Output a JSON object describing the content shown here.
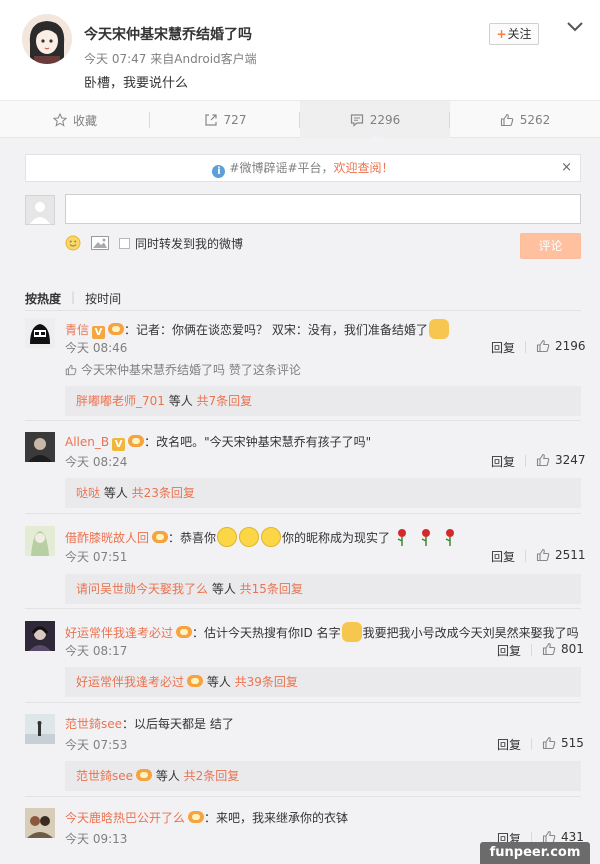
{
  "post": {
    "author": "今天宋仲基宋慧乔结婚了吗",
    "time": "今天 07:47",
    "source_prefix": "来自",
    "source": "Android客户端",
    "text": "卧槽，我要说什么",
    "follow_label": "关注"
  },
  "actions": {
    "favorite": "收藏",
    "repost": "727",
    "comment": "2296",
    "like": "5262"
  },
  "notice": {
    "text": "#微博辟谣#平台，",
    "welcome": "欢迎查阅！",
    "close": "×"
  },
  "composer": {
    "repost_label": "同时转发到我的微博",
    "submit": "评论"
  },
  "sort": {
    "hot": "按热度",
    "time": "按时间"
  },
  "comments": [
    {
      "name": "青信",
      "text": "：记者：你俩在谈恋爱吗？ 双宋：没有，我们准备结婚了",
      "time": "今天 08:46",
      "reply": "回复",
      "likes": "2196",
      "liked_note": "今天宋仲基宋慧乔结婚了吗 赞了这条评论",
      "sub_name": "胖嘟嘟老师_701",
      "sub_mid": " 等人 ",
      "sub_count": "共7条回复"
    },
    {
      "name": "Allen_B",
      "text": "：改名吧。\"今天宋钟基宋慧乔有孩子了吗\"",
      "time": "今天 08:24",
      "reply": "回复",
      "likes": "3247",
      "sub_name": "哒哒",
      "sub_mid": " 等人 ",
      "sub_count": "共23条回复"
    },
    {
      "name": "借酢膝晄故人回",
      "text_a": "：恭喜你",
      "text_b": "你的昵称成为现实了",
      "time": "今天 07:51",
      "reply": "回复",
      "likes": "2511",
      "sub_name": "请问吴世勋今天娶我了么",
      "sub_mid": " 等人 ",
      "sub_count": "共15条回复"
    },
    {
      "name": "好运常伴我逢考必过",
      "text_a": "：估计今天热搜有你ID 名字",
      "text_b": "我要把我小号改成今天刘昊然来娶我了吗",
      "time": "今天 08:17",
      "reply": "回复",
      "likes": "801",
      "sub_name": "好运常伴我逢考必过",
      "sub_mid": " 等人 ",
      "sub_count": "共39条回复"
    },
    {
      "name": "范世錡see",
      "text": "：以后每天都是 结了",
      "time": "今天 07:53",
      "reply": "回复",
      "likes": "515",
      "sub_name": "范世錡see",
      "sub_mid": " 等人 ",
      "sub_count": "共2条回复"
    },
    {
      "name": "今天鹿晗热巴公开了么",
      "text": "：来吧，我来继承你的衣钵",
      "time": "今天 09:13",
      "reply": "回复",
      "likes": "431"
    }
  ],
  "watermark": "funpeer.com",
  "colors": {
    "accent": "#eb7350",
    "comment_button": "#ffc09f",
    "page_bg": "#f2f2f5"
  }
}
